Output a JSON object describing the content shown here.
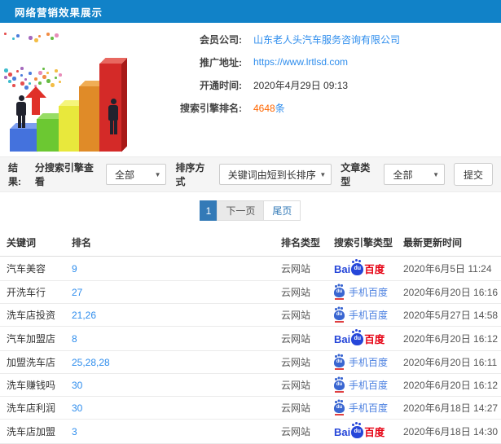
{
  "header": {
    "title": "网络营销效果展示"
  },
  "info": {
    "fields": [
      {
        "label": "会员公司:",
        "value": "山东老人头汽车服务咨询有限公司"
      },
      {
        "label": "推广地址:",
        "value": "https://www.lrtlsd.com"
      },
      {
        "label": "开通时间:",
        "value": "2020年4月29日 09:13"
      },
      {
        "label": "搜索引擎排名:",
        "value": "4648",
        "suffix": "条"
      }
    ]
  },
  "filters": {
    "result_label": "结果:",
    "engine_view_label": "分搜索引擎查看",
    "engine_view_value": "全部",
    "sort_label": "排序方式",
    "sort_value": "关键词由短到长排序",
    "article_type_label": "文章类型",
    "article_type_value": "全部",
    "submit_label": "提交",
    "caret": "▼"
  },
  "pagination": {
    "current": "1",
    "next_label": "下一页",
    "last_label": "尾页"
  },
  "table": {
    "headers": [
      "关键词",
      "排名",
      "排名类型",
      "搜索引擎类型",
      "最新更新时间"
    ],
    "engine_labels": {
      "baidu_pc": {
        "bai": "Bai",
        "du": "du",
        "baidu": "百度"
      },
      "baidu_mobile": {
        "du": "du",
        "label": "手机百度"
      }
    },
    "rows": [
      {
        "keyword": "汽车美容",
        "rank": "9",
        "rank_type": "云网站",
        "engine": "baidu_pc",
        "updated": "2020年6月5日 11:24"
      },
      {
        "keyword": "开洗车行",
        "rank": "27",
        "rank_type": "云网站",
        "engine": "baidu_mobile",
        "updated": "2020年6月20日 16:16"
      },
      {
        "keyword": "洗车店投资",
        "rank": "21,26",
        "rank_type": "云网站",
        "engine": "baidu_mobile",
        "updated": "2020年5月27日 14:58"
      },
      {
        "keyword": "汽车加盟店",
        "rank": "8",
        "rank_type": "云网站",
        "engine": "baidu_pc",
        "updated": "2020年6月20日 16:12"
      },
      {
        "keyword": "加盟洗车店",
        "rank": "25,28,28",
        "rank_type": "云网站",
        "engine": "baidu_mobile",
        "updated": "2020年6月20日 16:11"
      },
      {
        "keyword": "洗车赚钱吗",
        "rank": "30",
        "rank_type": "云网站",
        "engine": "baidu_mobile",
        "updated": "2020年6月20日 16:12"
      },
      {
        "keyword": "洗车店利润",
        "rank": "30",
        "rank_type": "云网站",
        "engine": "baidu_mobile",
        "updated": "2020年6月18日 14:27"
      },
      {
        "keyword": "洗车店加盟",
        "rank": "3",
        "rank_type": "云网站",
        "engine": "baidu_pc",
        "updated": "2020年6月18日 14:30"
      }
    ]
  },
  "colors": {
    "header_bg": "#1182c8",
    "link_blue": "#2e8ded",
    "count_orange": "#ff6600",
    "active_page_bg": "#337ab7",
    "baidu_blue": "#2546d9",
    "baidu_red": "#e60012",
    "mobile_blue": "#4a7fe0"
  }
}
